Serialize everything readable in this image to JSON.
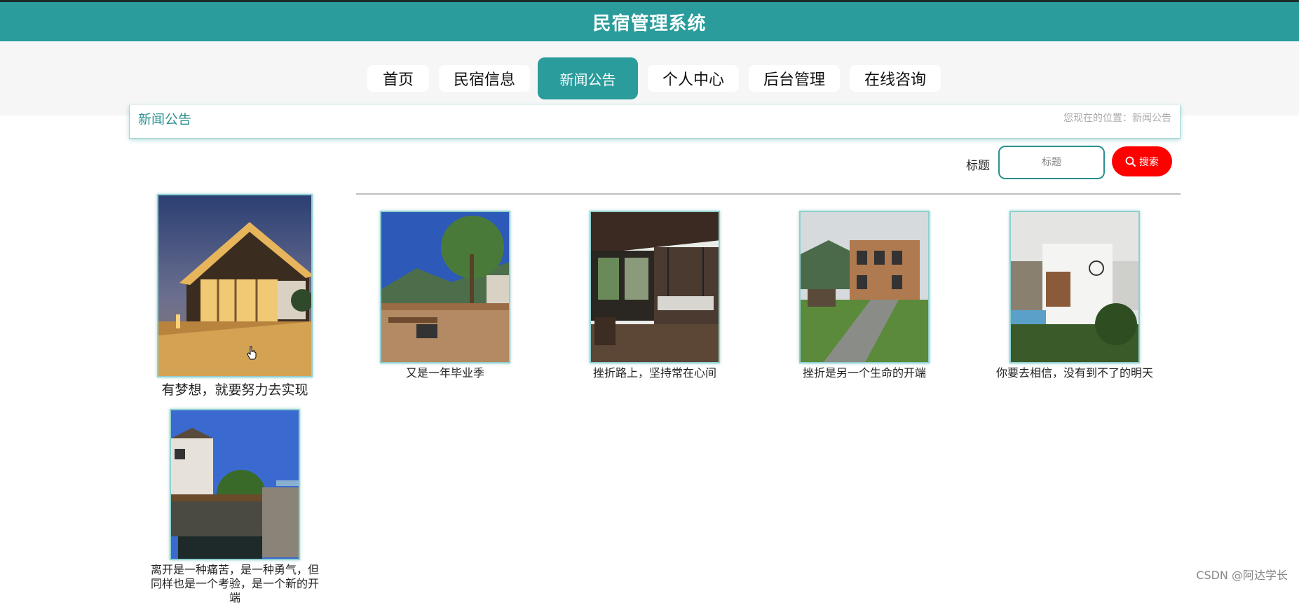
{
  "header": {
    "title": "民宿管理系统"
  },
  "nav": {
    "items": [
      {
        "label": "首页"
      },
      {
        "label": "民宿信息"
      },
      {
        "label": "新闻公告",
        "active": true
      },
      {
        "label": "个人中心"
      },
      {
        "label": "后台管理"
      },
      {
        "label": "在线咨询"
      }
    ]
  },
  "breadcrumb": {
    "title": "新闻公告",
    "position": "您现在的位置：新闻公告"
  },
  "search": {
    "label": "标题",
    "placeholder": "标题",
    "button_label": "搜索"
  },
  "news": [
    {
      "caption": "有梦想，就要努力去实现",
      "image": "modern-wooden-house-night-photo"
    },
    {
      "caption": "又是一年毕业季",
      "image": "deck-with-mountain-view-photo"
    },
    {
      "caption": "挫折路上，坚持常在心间",
      "image": "porch-swing-photo"
    },
    {
      "caption": "挫折是另一个生命的开端",
      "image": "stone-path-villa-photo"
    },
    {
      "caption": "你要去相信，没有到不了的明天",
      "image": "white-modern-villa-photo"
    },
    {
      "caption": "离开是一种痛苦，是一种勇气，但同样也是一个考验，是一个新的开端",
      "image": "cliffside-garden-villa-photo"
    }
  ],
  "watermark": "CSDN @阿达学长",
  "colors": {
    "primary": "#2a9c9c",
    "search_button": "#ff0000"
  }
}
